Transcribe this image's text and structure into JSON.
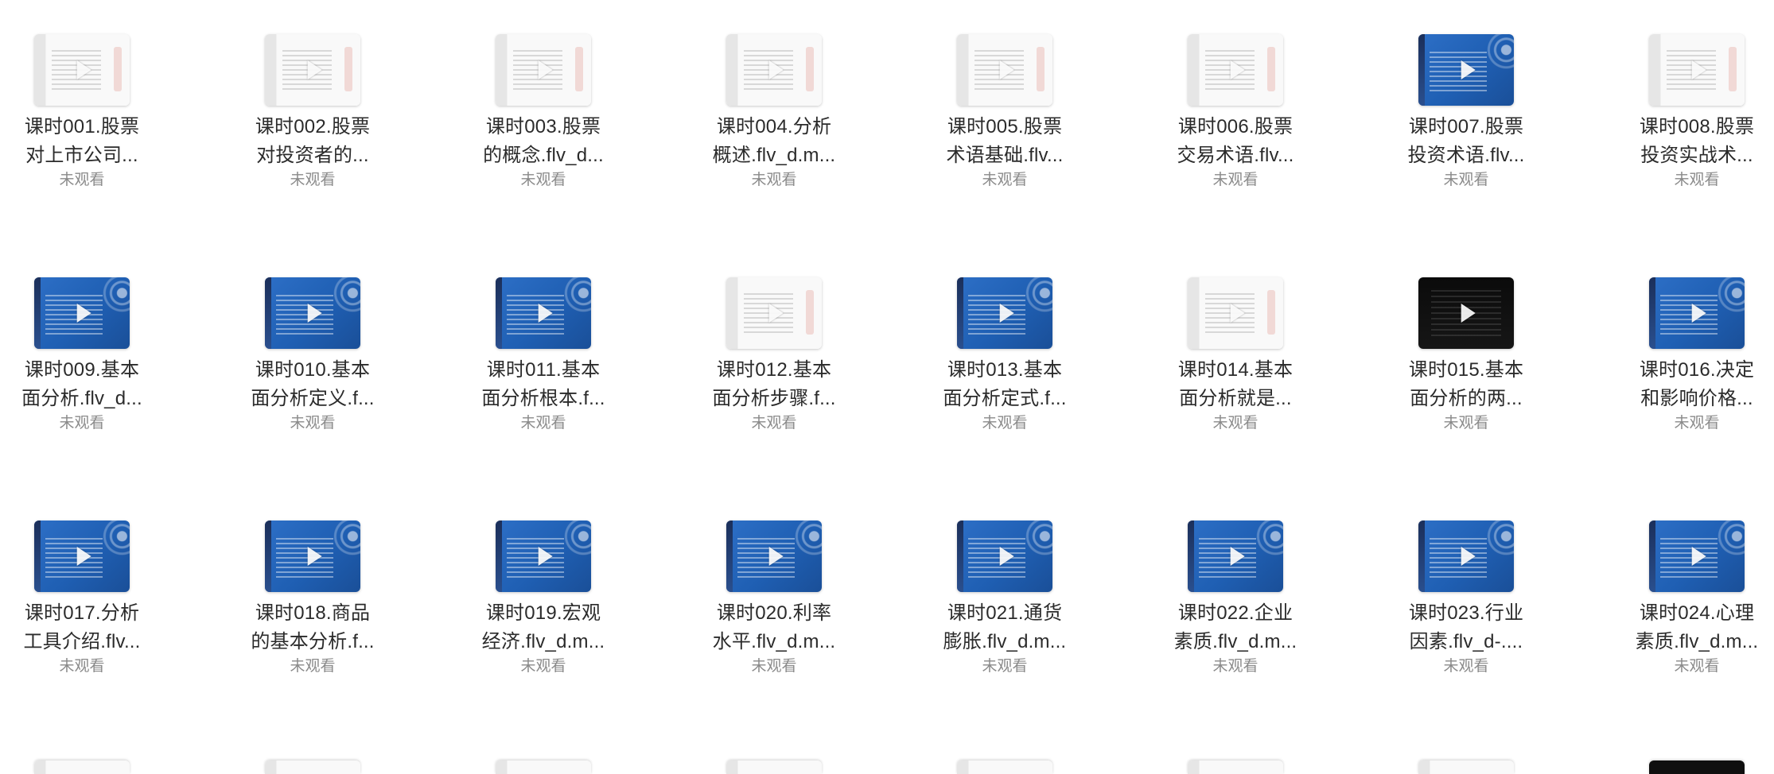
{
  "items": [
    {
      "title_line1": "课时001.股票",
      "title_line2": "对上市公司...",
      "status": "未观看",
      "thumb_style": "doc"
    },
    {
      "title_line1": "课时002.股票",
      "title_line2": "对投资者的...",
      "status": "未观看",
      "thumb_style": "doc"
    },
    {
      "title_line1": "课时003.股票",
      "title_line2": "的概念.flv_d...",
      "status": "未观看",
      "thumb_style": "doc"
    },
    {
      "title_line1": "课时004.分析",
      "title_line2": "概述.flv_d.m...",
      "status": "未观看",
      "thumb_style": "doc"
    },
    {
      "title_line1": "课时005.股票",
      "title_line2": "术语基础.flv...",
      "status": "未观看",
      "thumb_style": "doc"
    },
    {
      "title_line1": "课时006.股票",
      "title_line2": "交易术语.flv...",
      "status": "未观看",
      "thumb_style": "doc"
    },
    {
      "title_line1": "课时007.股票",
      "title_line2": "投资术语.flv...",
      "status": "未观看",
      "thumb_style": "blue"
    },
    {
      "title_line1": "课时008.股票",
      "title_line2": "投资实战术...",
      "status": "未观看",
      "thumb_style": "doc"
    },
    {
      "title_line1": "课时009.基本",
      "title_line2": "面分析.flv_d...",
      "status": "未观看",
      "thumb_style": "blue"
    },
    {
      "title_line1": "课时010.基本",
      "title_line2": "面分析定义.f...",
      "status": "未观看",
      "thumb_style": "blue"
    },
    {
      "title_line1": "课时011.基本",
      "title_line2": "面分析根本.f...",
      "status": "未观看",
      "thumb_style": "blue"
    },
    {
      "title_line1": "课时012.基本",
      "title_line2": "面分析步骤.f...",
      "status": "未观看",
      "thumb_style": "doc"
    },
    {
      "title_line1": "课时013.基本",
      "title_line2": "面分析定式.f...",
      "status": "未观看",
      "thumb_style": "blue"
    },
    {
      "title_line1": "课时014.基本",
      "title_line2": "面分析就是...",
      "status": "未观看",
      "thumb_style": "doc"
    },
    {
      "title_line1": "课时015.基本",
      "title_line2": "面分析的两...",
      "status": "未观看",
      "thumb_style": "dark"
    },
    {
      "title_line1": "课时016.决定",
      "title_line2": "和影响价格...",
      "status": "未观看",
      "thumb_style": "blue"
    },
    {
      "title_line1": "课时017.分析",
      "title_line2": "工具介绍.flv...",
      "status": "未观看",
      "thumb_style": "blue"
    },
    {
      "title_line1": "课时018.商品",
      "title_line2": "的基本分析.f...",
      "status": "未观看",
      "thumb_style": "blue"
    },
    {
      "title_line1": "课时019.宏观",
      "title_line2": "经济.flv_d.m...",
      "status": "未观看",
      "thumb_style": "blue"
    },
    {
      "title_line1": "课时020.利率",
      "title_line2": "水平.flv_d.m...",
      "status": "未观看",
      "thumb_style": "blue"
    },
    {
      "title_line1": "课时021.通货",
      "title_line2": "膨胀.flv_d.m...",
      "status": "未观看",
      "thumb_style": "blue"
    },
    {
      "title_line1": "课时022.企业",
      "title_line2": "素质.flv_d.m...",
      "status": "未观看",
      "thumb_style": "blue"
    },
    {
      "title_line1": "课时023.行业",
      "title_line2": "因素.flv_d-....",
      "status": "未观看",
      "thumb_style": "blue"
    },
    {
      "title_line1": "课时024.心理",
      "title_line2": "素质.flv_d.m...",
      "status": "未观看",
      "thumb_style": "blue"
    }
  ],
  "partial_row_thumbs": [
    "doc",
    "doc",
    "doc",
    "doc",
    "doc",
    "doc",
    "doc",
    "dark"
  ],
  "icons": {
    "play": "play-icon"
  },
  "colors": {
    "title_text": "#2b2b2b",
    "status_text": "#8a8a8a"
  }
}
